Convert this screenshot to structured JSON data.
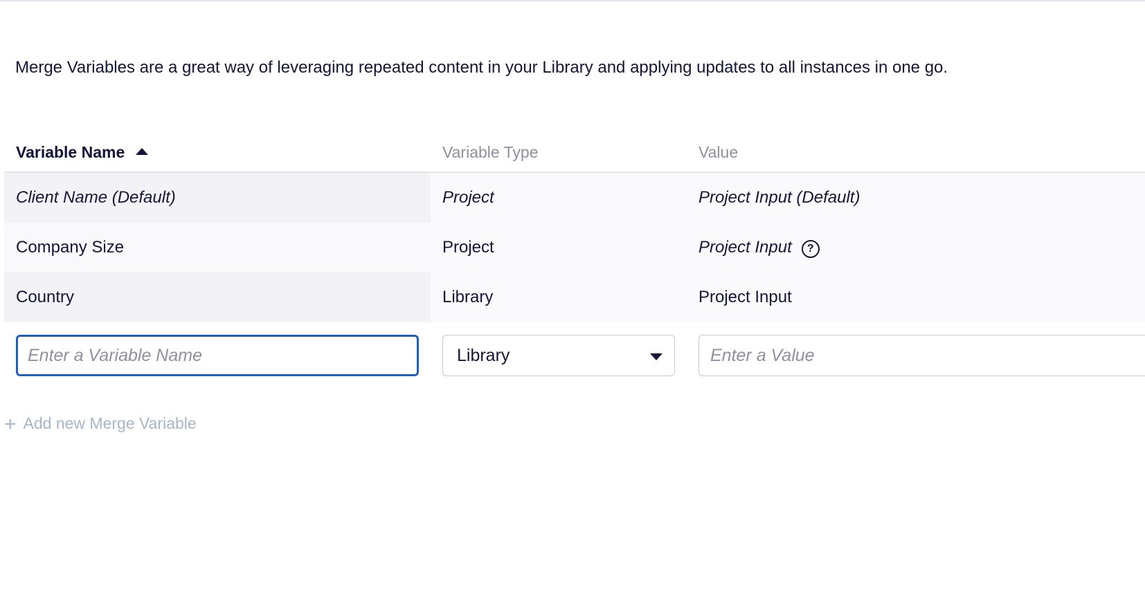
{
  "description": "Merge Variables are a great way of leveraging repeated content in your Library and applying updates to all instances in one go.",
  "table": {
    "columns": {
      "name": "Variable Name",
      "type": "Variable Type",
      "value": "Value"
    },
    "sort": {
      "column": "Variable Name",
      "direction": "ascending",
      "icon": "sort-ascending-icon"
    },
    "rows": [
      {
        "name": "Client Name (Default)",
        "type": "Project",
        "value": "Project Input (Default)"
      },
      {
        "name": "Company Size",
        "type": "Project",
        "value": "Project Input",
        "value_icon": "help-circle-icon",
        "value_icon_glyph": "?"
      },
      {
        "name": "Country",
        "type": "Library",
        "value": "Project Input"
      }
    ]
  },
  "new_row": {
    "name_placeholder": "Enter a Variable Name",
    "type_selected": "Library",
    "value_placeholder": "Enter a Value"
  },
  "add_button": {
    "label": "Add new Merge Variable",
    "icon_glyph": "+"
  },
  "colors": {
    "focus_border": "#1f5fbf",
    "link": "#a7b6c8",
    "text": "#16163a",
    "muted": "#8f8f9f"
  }
}
